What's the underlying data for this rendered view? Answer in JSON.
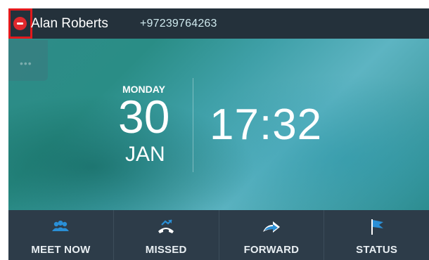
{
  "header": {
    "user_name": "Alan Roberts",
    "user_number": "+97239764263",
    "presence_status_color": "#e0282d"
  },
  "home": {
    "menu_dots": "•••",
    "day": "MONDAY",
    "date": "30",
    "month": "JAN",
    "time": "17:32"
  },
  "softkeys": [
    {
      "label": "MEET NOW",
      "icon": "people-icon"
    },
    {
      "label": "MISSED",
      "icon": "missed-call-icon"
    },
    {
      "label": "FORWARD",
      "icon": "forward-arrow-icon"
    },
    {
      "label": "STATUS",
      "icon": "flag-icon"
    }
  ],
  "colors": {
    "accent": "#2a8fd6",
    "highlight_border": "#e3191c"
  }
}
